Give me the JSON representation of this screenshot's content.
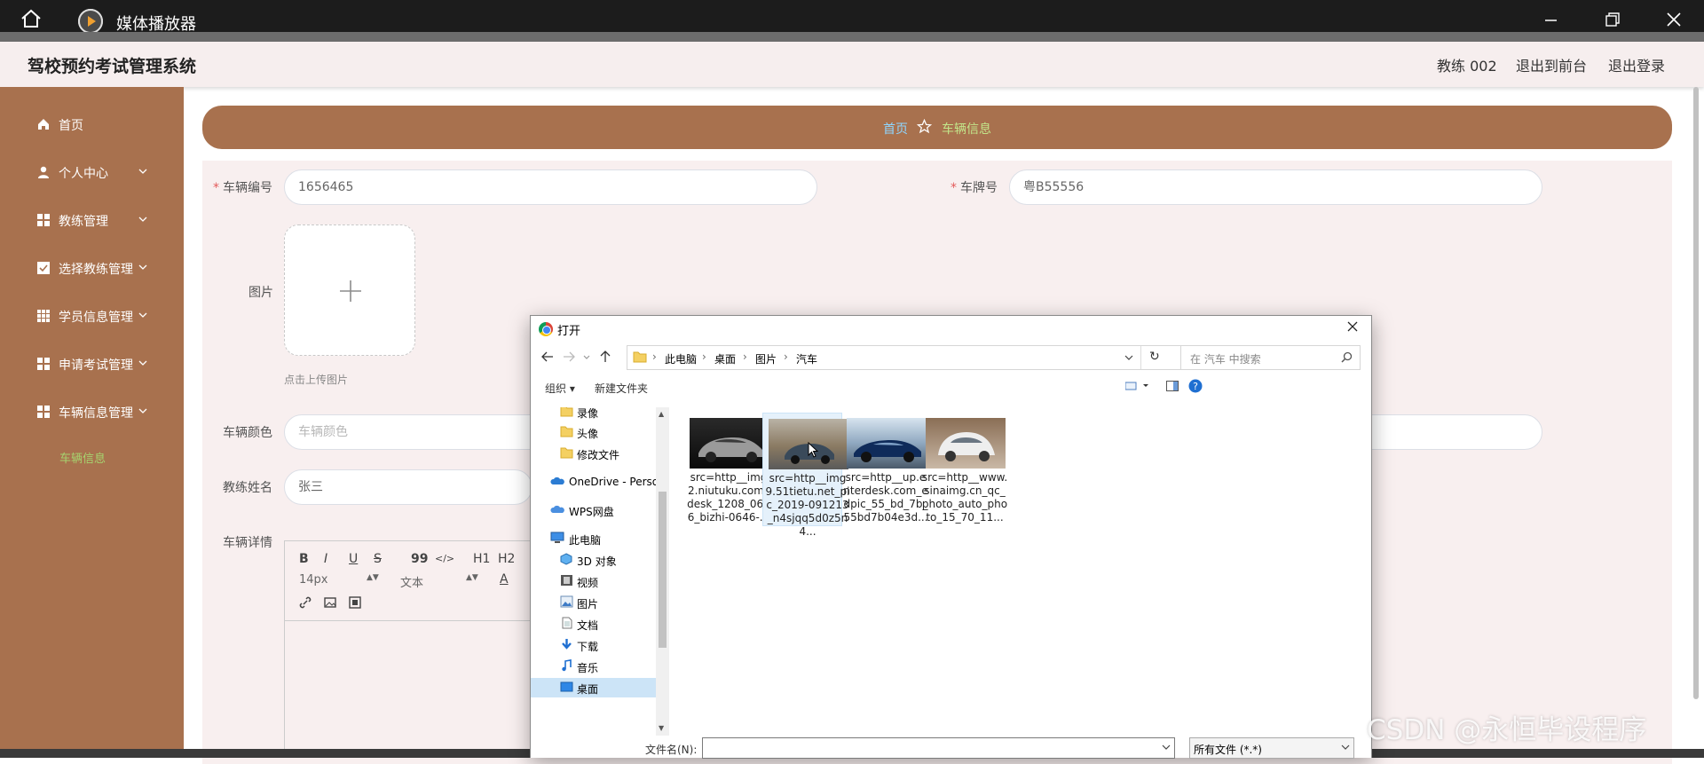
{
  "window": {
    "title": "媒体播放器",
    "icons": [
      "home-icon",
      "player-logo-icon",
      "minimize-icon",
      "restore-icon",
      "close-icon"
    ]
  },
  "header": {
    "brand": "驾校预约考试管理系统",
    "user": "教练 002",
    "to_front": "退出到前台",
    "logout": "退出登录"
  },
  "sidebar": {
    "items": [
      {
        "label": "首页",
        "icon": "home-icon",
        "expandable": false
      },
      {
        "label": "个人中心",
        "icon": "user-icon",
        "expandable": true
      },
      {
        "label": "教练管理",
        "icon": "grid-icon",
        "expandable": true
      },
      {
        "label": "选择教练管理",
        "icon": "checklist-icon",
        "expandable": true
      },
      {
        "label": "学员信息管理",
        "icon": "grid-icon",
        "expandable": true
      },
      {
        "label": "申请考试管理",
        "icon": "grid-icon",
        "expandable": true
      },
      {
        "label": "车辆信息管理",
        "icon": "grid-icon",
        "expandable": true
      }
    ],
    "active_sub": "车辆信息",
    "bg_color": "#a8714e",
    "active_color": "#a6d36f"
  },
  "breadcrumb": {
    "home": "首页",
    "current": "车辆信息",
    "home_color": "#8fd6ff",
    "current_color": "#c2e58a"
  },
  "form": {
    "vehicle_no_label": "车辆编号",
    "vehicle_no_value": "1656465",
    "plate_label": "车牌号",
    "plate_value": "粤B55556",
    "image_label": "图片",
    "upload_tip": "点击上传图片",
    "color_label": "车辆颜色",
    "color_placeholder": "车辆颜色",
    "coach_label": "教练姓名",
    "coach_value": "张三",
    "details_label": "车辆详情",
    "editor": {
      "bold": "B",
      "italic": "I",
      "underline": "U",
      "strike": "S",
      "quote": "99",
      "code": "</>",
      "h1": "H1",
      "h2": "H2",
      "font_size": "14px",
      "paragraph": "文本",
      "font_color": "A"
    }
  },
  "dialog": {
    "title": "打开",
    "path": [
      "此电脑",
      "桌面",
      "图片",
      "汽车"
    ],
    "search_placeholder": "在 汽车 中搜索",
    "organize": "组织",
    "new_folder": "新建文件夹",
    "tree": [
      {
        "label": "录像",
        "icon": "folder-icon"
      },
      {
        "label": "头像",
        "icon": "folder-icon"
      },
      {
        "label": "修改文件",
        "icon": "folder-icon"
      },
      {
        "label": "OneDrive - Perso",
        "icon": "onedrive-icon"
      },
      {
        "label": "WPS网盘",
        "icon": "cloud-icon"
      },
      {
        "label": "此电脑",
        "icon": "computer-icon"
      },
      {
        "label": "3D 对象",
        "icon": "cube-icon"
      },
      {
        "label": "视频",
        "icon": "video-icon"
      },
      {
        "label": "图片",
        "icon": "pictures-icon"
      },
      {
        "label": "文档",
        "icon": "document-icon"
      },
      {
        "label": "下载",
        "icon": "download-icon"
      },
      {
        "label": "音乐",
        "icon": "music-icon"
      },
      {
        "label": "桌面",
        "icon": "desktop-icon"
      }
    ],
    "files": [
      {
        "name": "src=http__img2.niutuku.com_desk_1208_0646_bizhi-0646-...",
        "selected": false
      },
      {
        "name": "src=http__img9.51tietu.net_pic_2019-091213_n4sjqq5d0z5n4...",
        "selected": true
      },
      {
        "name": "src=http__up.enterdesk.com_edpic_55_bd_7b_55bd7b04e3d...",
        "selected": false
      },
      {
        "name": "src=http__www.sinaimg.cn_qc_photo_auto_photo_15_70_11...",
        "selected": false
      }
    ],
    "filename_label": "文件名(N):",
    "filename_value": "",
    "filetype_value": "所有文件 (*.*)"
  },
  "watermark": "CSDN @永恒毕设程序"
}
